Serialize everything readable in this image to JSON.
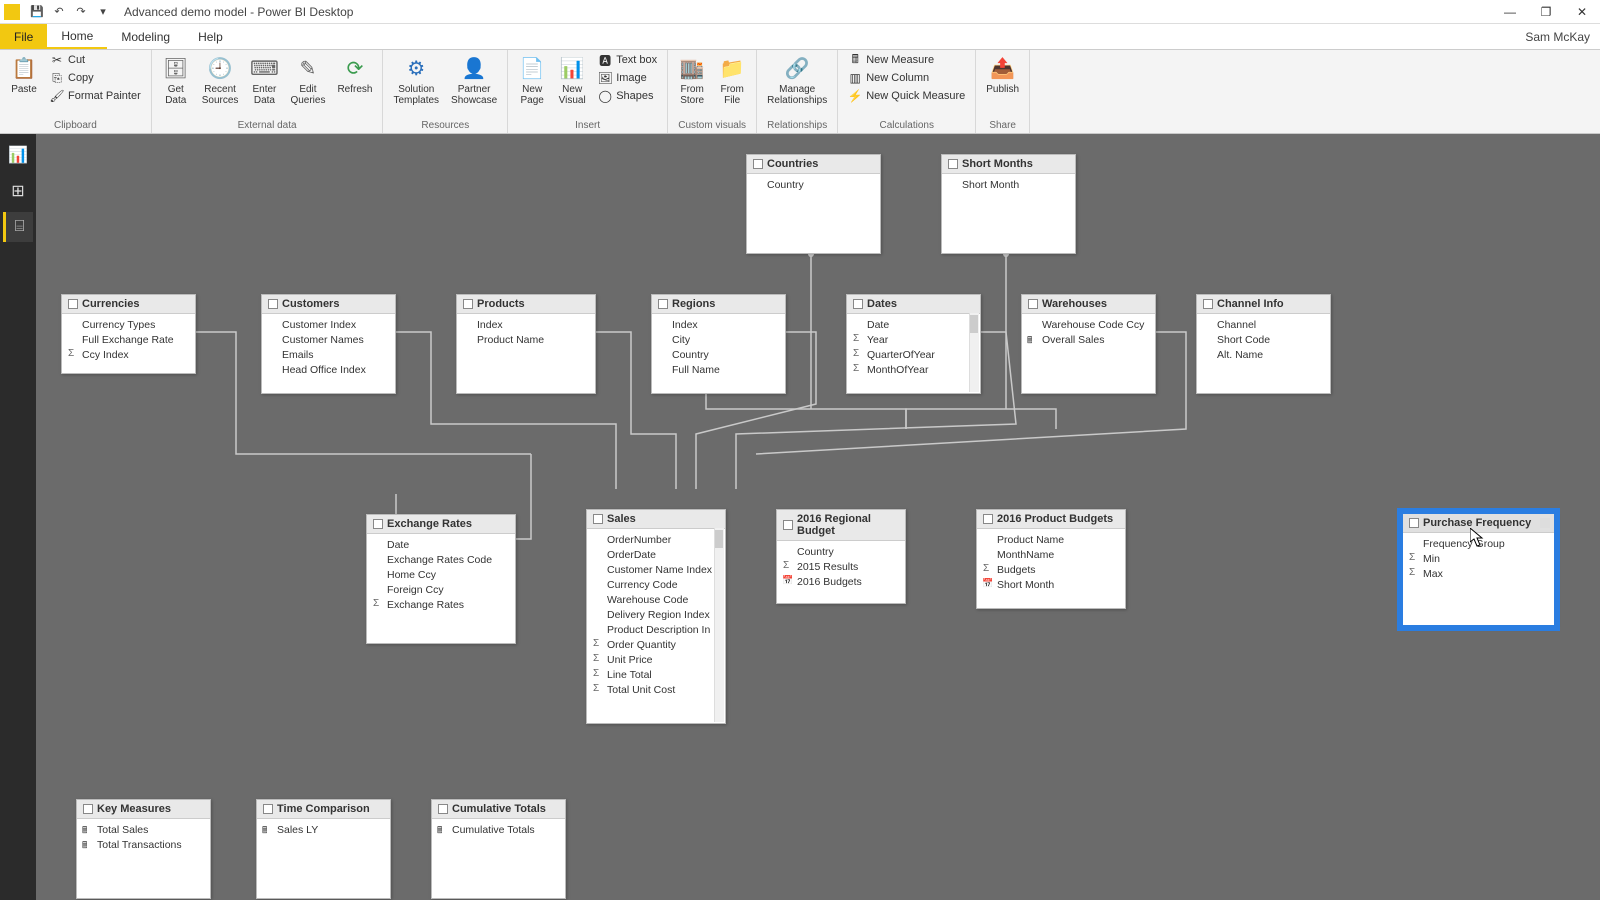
{
  "window": {
    "title": "Advanced demo model - Power BI Desktop",
    "user": "Sam McKay"
  },
  "menubar": {
    "file": "File",
    "home": "Home",
    "modeling": "Modeling",
    "help": "Help"
  },
  "ribbon": {
    "clipboard": {
      "label": "Clipboard",
      "paste": "Paste",
      "cut": "Cut",
      "copy": "Copy",
      "format_painter": "Format Painter"
    },
    "external_data": {
      "label": "External data",
      "get_data": "Get\nData",
      "recent_sources": "Recent\nSources",
      "enter_data": "Enter\nData",
      "edit_queries": "Edit\nQueries",
      "refresh": "Refresh"
    },
    "resources": {
      "label": "Resources",
      "solution_templates": "Solution\nTemplates",
      "partner_showcase": "Partner\nShowcase"
    },
    "insert": {
      "label": "Insert",
      "new_page": "New\nPage",
      "new_visual": "New\nVisual",
      "text_box": "Text box",
      "image": "Image",
      "shapes": "Shapes"
    },
    "custom_visuals": {
      "label": "Custom visuals",
      "from_store": "From\nStore",
      "from_file": "From\nFile"
    },
    "relationships": {
      "label": "Relationships",
      "manage": "Manage\nRelationships"
    },
    "calculations": {
      "label": "Calculations",
      "new_measure": "New Measure",
      "new_column": "New Column",
      "new_quick_measure": "New Quick Measure"
    },
    "share": {
      "label": "Share",
      "publish": "Publish"
    }
  },
  "tables": {
    "countries": {
      "name": "Countries",
      "fields": [
        "Country"
      ]
    },
    "short_months": {
      "name": "Short Months",
      "fields": [
        "Short Month"
      ]
    },
    "currencies": {
      "name": "Currencies",
      "fields": [
        "Currency Types",
        "Full Exchange Rate",
        "Ccy Index"
      ],
      "sigma": [
        2
      ]
    },
    "customers": {
      "name": "Customers",
      "fields": [
        "Customer Index",
        "Customer Names",
        "Emails",
        "Head Office Index"
      ]
    },
    "products": {
      "name": "Products",
      "fields": [
        "Index",
        "Product Name"
      ]
    },
    "regions": {
      "name": "Regions",
      "fields": [
        "Index",
        "City",
        "Country",
        "Full Name"
      ]
    },
    "dates": {
      "name": "Dates",
      "fields": [
        "Date",
        "Year",
        "QuarterOfYear",
        "MonthOfYear"
      ],
      "sigma": [
        1,
        2,
        3
      ]
    },
    "warehouses": {
      "name": "Warehouses",
      "fields": [
        "Warehouse Code Ccy",
        "Overall Sales"
      ],
      "calc": [
        1
      ]
    },
    "channel_info": {
      "name": "Channel Info",
      "fields": [
        "Channel",
        "Short Code",
        "Alt. Name"
      ]
    },
    "exchange_rates": {
      "name": "Exchange Rates",
      "fields": [
        "Date",
        "Exchange Rates Code",
        "Home Ccy",
        "Foreign Ccy",
        "Exchange Rates"
      ],
      "sigma": [
        4
      ]
    },
    "sales": {
      "name": "Sales",
      "fields": [
        "OrderNumber",
        "OrderDate",
        "Customer Name Index",
        "Currency Code",
        "Warehouse Code",
        "Delivery Region Index",
        "Product Description In",
        "Order Quantity",
        "Unit Price",
        "Line Total",
        "Total Unit Cost"
      ],
      "sigma": [
        7,
        8,
        9,
        10
      ]
    },
    "regional_budget": {
      "name": "2016 Regional Budget",
      "fields": [
        "Country",
        "2015 Results",
        "2016 Budgets"
      ],
      "sigma": [
        1
      ],
      "date": [
        2
      ]
    },
    "product_budgets": {
      "name": "2016 Product Budgets",
      "fields": [
        "Product Name",
        "MonthName",
        "Budgets",
        "Short Month"
      ],
      "sigma": [
        2
      ],
      "date": [
        3
      ]
    },
    "purchase_frequency": {
      "name": "Purchase Frequency",
      "fields": [
        "Frequency Group",
        "Min",
        "Max"
      ],
      "sigma": [
        1,
        2
      ]
    },
    "key_measures": {
      "name": "Key Measures",
      "fields": [
        "Total Sales",
        "Total Transactions"
      ],
      "calc": [
        0,
        1
      ]
    },
    "time_comparison": {
      "name": "Time Comparison",
      "fields": [
        "Sales LY"
      ],
      "calc": [
        0
      ]
    },
    "cumulative_totals": {
      "name": "Cumulative Totals",
      "fields": [
        "Cumulative Totals"
      ],
      "calc": [
        0
      ]
    }
  }
}
